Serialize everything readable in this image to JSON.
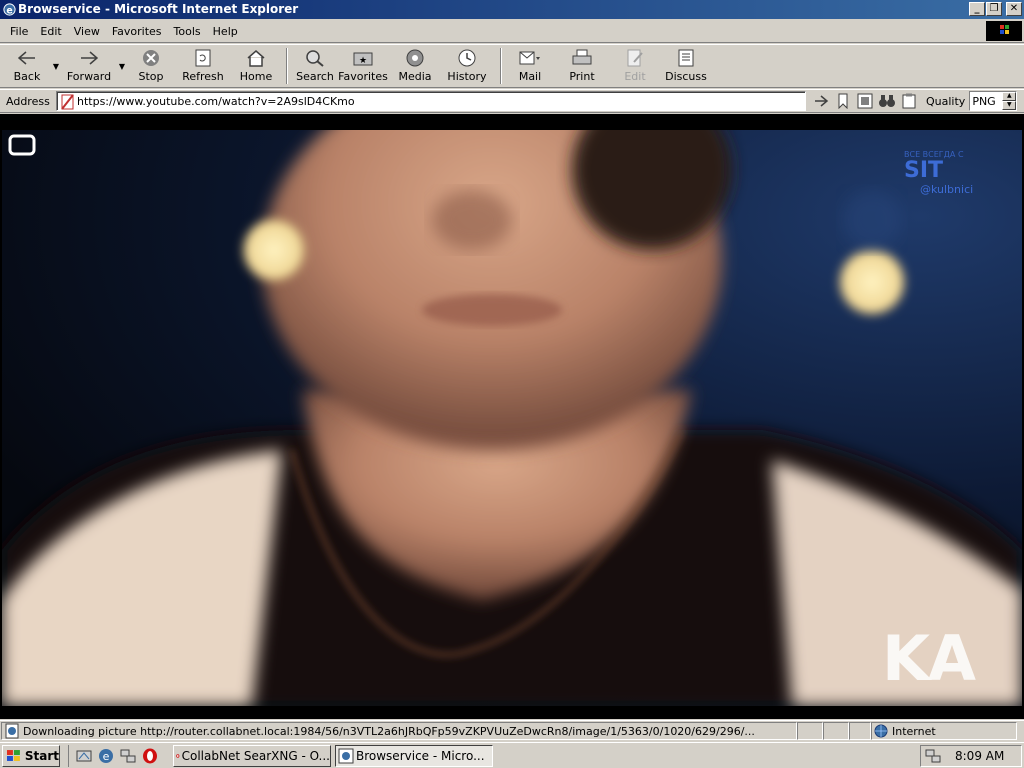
{
  "window": {
    "title": "Browservice - Microsoft Internet Explorer",
    "controls": {
      "minimize": "_",
      "maximize": "❐",
      "close": "✕"
    }
  },
  "menubar": {
    "items": [
      {
        "label": "File"
      },
      {
        "label": "Edit"
      },
      {
        "label": "View"
      },
      {
        "label": "Favorites"
      },
      {
        "label": "Tools"
      },
      {
        "label": "Help"
      }
    ]
  },
  "toolbar": {
    "back": "Back",
    "forward": "Forward",
    "stop": "Stop",
    "refresh": "Refresh",
    "home": "Home",
    "search": "Search",
    "favorites": "Favorites",
    "media": "Media",
    "history": "History",
    "mail": "Mail",
    "print": "Print",
    "edit": "Edit",
    "discuss": "Discuss"
  },
  "address": {
    "label": "Address",
    "url": "https://www.youtube.com/watch?v=2A9slD4CKmo",
    "quality_label": "Quality",
    "quality_value": "PNG"
  },
  "video": {
    "watermark_line1": "ВСЕ ВСЕГДА С",
    "watermark_line2": "SIT",
    "watermark_line3": "@kulbnici",
    "caption_fragment": "KA"
  },
  "status": {
    "text": "Downloading picture http://router.collabnet.local:1984/56/n3VTL2a6hJRbQFp59vZKPVUuZeDwcRn8/image/1/5363/0/1020/629/296/...",
    "zone": "Internet"
  },
  "taskbar": {
    "start": "Start",
    "tasks": [
      {
        "label": "CollabNet SearXNG - O..."
      },
      {
        "label": "Browservice - Micro..."
      }
    ],
    "clock": "8:09 AM"
  },
  "colors": {
    "titlebar_start": "#0a246a",
    "titlebar_end": "#3a6ea5",
    "chrome": "#d4d0c8"
  }
}
